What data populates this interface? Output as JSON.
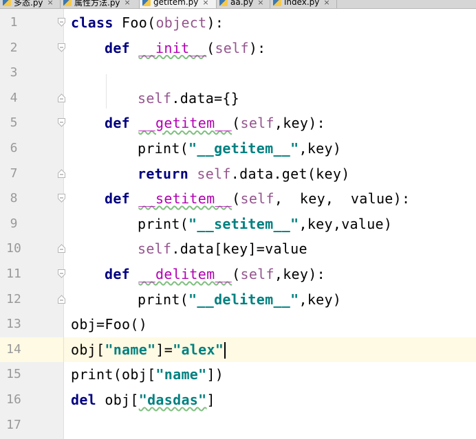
{
  "tabs": [
    {
      "label": "多态.py",
      "close": "×"
    },
    {
      "label": "属性方法.py",
      "close": "×"
    },
    {
      "label": "getitem.py",
      "close": "×"
    },
    {
      "label": "aa.py",
      "close": "×"
    },
    {
      "label": "index.py",
      "close": "×"
    }
  ],
  "active_tab": "getitem.py",
  "current_line": 14,
  "lines": [
    {
      "n": "1"
    },
    {
      "n": "2"
    },
    {
      "n": "3"
    },
    {
      "n": "4"
    },
    {
      "n": "5"
    },
    {
      "n": "6"
    },
    {
      "n": "7"
    },
    {
      "n": "8"
    },
    {
      "n": "9"
    },
    {
      "n": "10"
    },
    {
      "n": "11"
    },
    {
      "n": "12"
    },
    {
      "n": "13"
    },
    {
      "n": "14"
    },
    {
      "n": "15"
    },
    {
      "n": "16"
    },
    {
      "n": "17"
    }
  ],
  "code": {
    "l1": {
      "kw": "class",
      "name": " Foo(",
      "base": "object",
      "end": "):"
    },
    "l2": {
      "kw": "def",
      "sp": " ",
      "fn": "__init__",
      "open": "(",
      "self": "self",
      "end": "):"
    },
    "l4": {
      "self": "self",
      "rest": ".data={}"
    },
    "l5": {
      "kw": "def",
      "sp": " ",
      "fn": "__getitem__",
      "open": "(",
      "self": "self",
      "end": ",key):"
    },
    "l6": {
      "pre": "print(",
      "str": "\"__getitem__\"",
      "end": ",key)"
    },
    "l7": {
      "kw": "return",
      "sp": " ",
      "self": "self",
      "rest": ".data.get(key)"
    },
    "l8": {
      "kw": "def",
      "sp": " ",
      "fn": "__setitem__",
      "open": "(",
      "self": "self",
      "end": ",  key,  value):"
    },
    "l9": {
      "pre": "print(",
      "str": "\"__setitem__\"",
      "end": ",key,value)"
    },
    "l10": {
      "self": "self",
      "rest": ".data[key]=value"
    },
    "l11": {
      "kw": "def",
      "sp": " ",
      "fn": "__delitem__",
      "open": "(",
      "self": "self",
      "end": ",key):"
    },
    "l12": {
      "pre": "print(",
      "str": "\"__delitem__\"",
      "end": ",key)"
    },
    "l13": {
      "text": "obj=Foo()"
    },
    "l14": {
      "pre": "obj[",
      "str1": "\"name\"",
      "mid": "]=",
      "str2": "\"alex\""
    },
    "l15": {
      "pre": "print(obj[",
      "str": "\"name\"",
      "end": "])"
    },
    "l16": {
      "kw": "del",
      "pre": " obj[",
      "str": "\"dasdas\"",
      "end": "]"
    }
  },
  "colors": {
    "keyword": "#000080",
    "self": "#94558d",
    "magic": "#b200b2",
    "string": "#008080",
    "gutter_bg": "#f0f0f0",
    "current_line_bg": "#fffae3"
  }
}
